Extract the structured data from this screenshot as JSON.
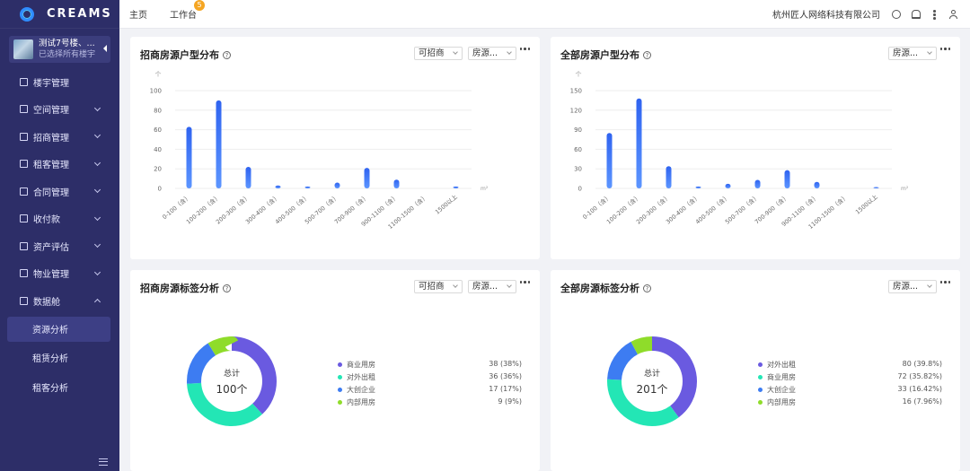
{
  "app": {
    "logo_text": "CREAMS"
  },
  "sidebar": {
    "project_name": "测试7号楼、...",
    "project_sub": "已选择所有楼宇",
    "items": [
      {
        "label": "楼宇管理",
        "chevron": false
      },
      {
        "label": "空间管理",
        "chevron": true
      },
      {
        "label": "招商管理",
        "chevron": true
      },
      {
        "label": "租客管理",
        "chevron": true
      },
      {
        "label": "合同管理",
        "chevron": true
      },
      {
        "label": "收付款",
        "chevron": true
      },
      {
        "label": "资产评估",
        "chevron": true
      },
      {
        "label": "物业管理",
        "chevron": true
      },
      {
        "label": "数据舱",
        "chevron": true
      }
    ],
    "sub_items": [
      {
        "label": "资源分析",
        "active": true
      },
      {
        "label": "租赁分析",
        "active": false
      },
      {
        "label": "租客分析",
        "active": false
      }
    ]
  },
  "topbar": {
    "tabs": [
      {
        "label": "主页"
      },
      {
        "label": "工作台",
        "badge": "5"
      }
    ],
    "company": "杭州匠人网络科技有限公司"
  },
  "cards": {
    "bar1": {
      "title": "招商房源户型分布",
      "filter1": "可招商",
      "filter2": "房源..."
    },
    "bar2": {
      "title": "全部房源户型分布",
      "filter1": "房源..."
    },
    "donut1": {
      "title": "招商房源标签分析",
      "filter1": "可招商",
      "filter2": "房源...",
      "center_label": "总计",
      "center_total": "100个"
    },
    "donut2": {
      "title": "全部房源标签分析",
      "filter1": "房源...",
      "center_label": "总计",
      "center_total": "201个"
    }
  },
  "colors": {
    "sidebar": "#2d2e68",
    "bar": "#3a73f5",
    "purple": "#6a5ae0",
    "teal": "#23e6b5",
    "blue": "#3d7cf2",
    "green": "#8fdc2a"
  },
  "chart_data": [
    {
      "type": "bar",
      "title": "招商房源户型分布",
      "ylabel": "个",
      "xlabel": "m²",
      "ylim": [
        0,
        100
      ],
      "yticks": [
        0,
        20,
        40,
        60,
        80,
        100
      ],
      "categories": [
        "0-100（含）",
        "100-200（含）",
        "200-300（含）",
        "300-400（含）",
        "400-500（含）",
        "500-700（含）",
        "700-900（含）",
        "900-1100（含）",
        "1100-1500（含）",
        "1500以上"
      ],
      "values": [
        63,
        90,
        22,
        3,
        2,
        6,
        21,
        9,
        0,
        2
      ]
    },
    {
      "type": "bar",
      "title": "全部房源户型分布",
      "ylabel": "个",
      "xlabel": "m²",
      "ylim": [
        0,
        150
      ],
      "yticks": [
        0,
        30,
        60,
        90,
        120,
        150
      ],
      "categories": [
        "0-100（含）",
        "100-200（含）",
        "200-300（含）",
        "300-400（含）",
        "400-500（含）",
        "500-700（含）",
        "700-900（含）",
        "900-1100（含）",
        "1100-1500（含）",
        "1500以上"
      ],
      "values": [
        85,
        138,
        34,
        3,
        7,
        13,
        28,
        10,
        0,
        2
      ]
    },
    {
      "type": "pie",
      "title": "招商房源标签分析",
      "slices": [
        {
          "label": "商业用房",
          "value": 38,
          "display": "38 (38%)",
          "color": "#6a5ae0"
        },
        {
          "label": "对外出租",
          "value": 36,
          "display": "36 (36%)",
          "color": "#23e6b5"
        },
        {
          "label": "大创企业",
          "value": 17,
          "display": "17 (17%)",
          "color": "#3d7cf2"
        },
        {
          "label": "内部用房",
          "value": 9,
          "display": "9 (9%)",
          "color": "#8fdc2a"
        }
      ]
    },
    {
      "type": "pie",
      "title": "全部房源标签分析",
      "slices": [
        {
          "label": "对外出租",
          "value": 80,
          "display": "80 (39.8%)",
          "color": "#6a5ae0"
        },
        {
          "label": "商业用房",
          "value": 72,
          "display": "72 (35.82%)",
          "color": "#23e6b5"
        },
        {
          "label": "大创企业",
          "value": 33,
          "display": "33 (16.42%)",
          "color": "#3d7cf2"
        },
        {
          "label": "内部用房",
          "value": 16,
          "display": "16 (7.96%)",
          "color": "#8fdc2a"
        }
      ]
    }
  ]
}
